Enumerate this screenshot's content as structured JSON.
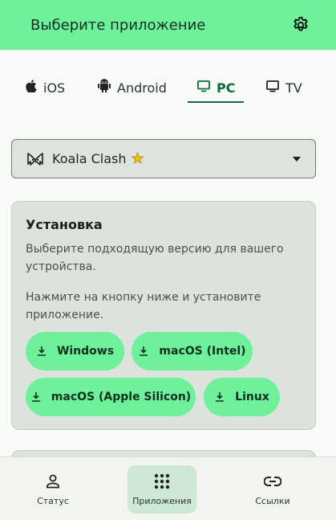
{
  "header": {
    "title": "Выберите приложение",
    "settings_icon": "gear-icon"
  },
  "tabs": [
    {
      "label": "iOS",
      "icon": "apple-icon"
    },
    {
      "label": "Android",
      "icon": "android-icon"
    },
    {
      "label": "PC",
      "icon": "monitor-icon",
      "active": true
    },
    {
      "label": "TV",
      "icon": "tv-icon"
    }
  ],
  "app_select": {
    "value": "Koala Clash",
    "badge_icon": "star-icon"
  },
  "install_card": {
    "title": "Установка",
    "text1": "Выберите подходящую версию для вашего устройства.",
    "text2": "Нажмите на кнопку ниже и установите приложение.",
    "buttons": [
      {
        "label": "Windows"
      },
      {
        "label": "macOS (Intel)"
      },
      {
        "label": "macOS (Apple Silicon)"
      },
      {
        "label": "Linux"
      }
    ]
  },
  "bottom_nav": [
    {
      "label": "Статус",
      "icon": "person-icon"
    },
    {
      "label": "Приложения",
      "icon": "apps-grid-icon",
      "active": true
    },
    {
      "label": "Ссылки",
      "icon": "link-icon"
    }
  ],
  "colors": {
    "accent": "#6ff09b",
    "active_tab": "#0d6b43",
    "card_bg": "#dde2dc"
  }
}
